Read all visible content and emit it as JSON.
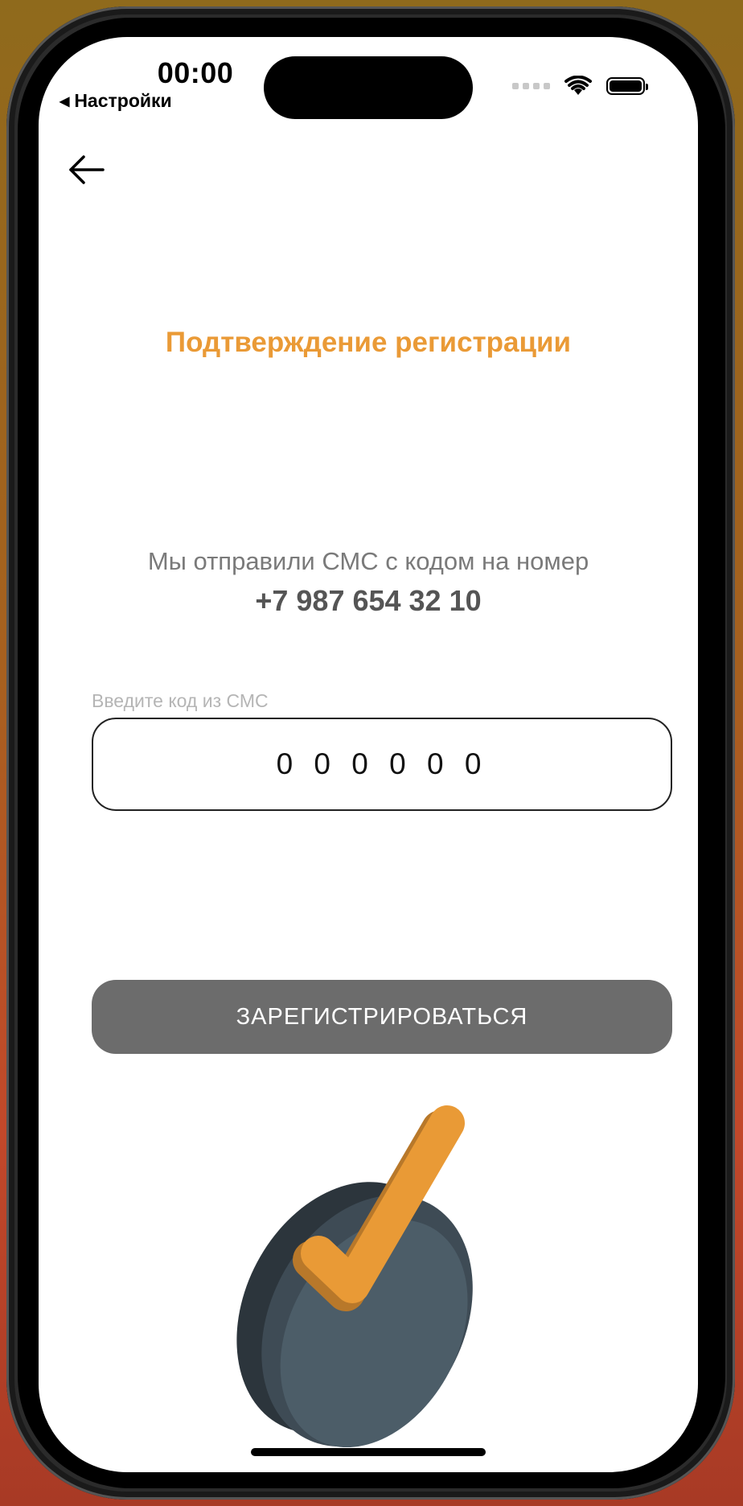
{
  "status_bar": {
    "time": "00:00",
    "back_app_label": "Настройки"
  },
  "page": {
    "title": "Подтверждение регистрации",
    "info_text": "Мы отправили СМС с кодом на номер",
    "phone_number": "+7 987 654 32 10",
    "code_label": "Введите код из СМС",
    "code_value": "000000",
    "code_display": "0 0 0 0 0 0",
    "register_button": "ЗАРЕГИСТРИРОВАТЬСЯ"
  },
  "colors": {
    "accent": "#ea9a36",
    "button_bg": "#6c6c6c",
    "text_gray": "#7a7a7a"
  },
  "icons": {
    "back": "arrow-left-icon",
    "wifi": "wifi-icon",
    "battery": "battery-icon",
    "illustration": "checkmark-badge-icon"
  }
}
